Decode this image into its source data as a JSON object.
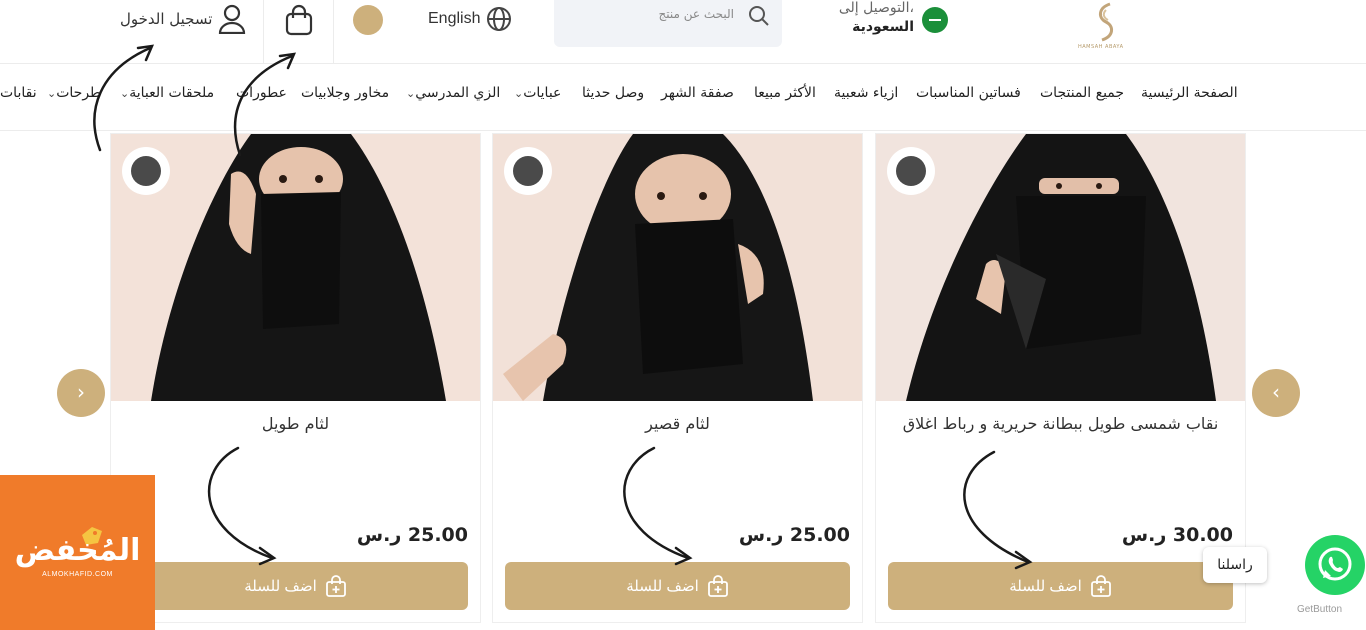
{
  "header": {
    "deliver_to_label": "التوصيل إلى،",
    "deliver_country": "السعودية",
    "search_placeholder": "البحث عن منتج",
    "language_label": "English",
    "login_label": "تسجيل الدخول",
    "logo_caption": "HAMSAH ABAYA",
    "brand_color": "#cdb07c"
  },
  "nav": {
    "items": [
      {
        "label": "الصفحة الرئيسية"
      },
      {
        "label": "جميع المنتجات"
      },
      {
        "label": "فساتين المناسبات"
      },
      {
        "label": "ازياء شعبية"
      },
      {
        "label": "الأكثر مبيعا"
      },
      {
        "label": "صفقة الشهر"
      },
      {
        "label": "وصل حديثا"
      },
      {
        "label": "عبايات",
        "has_dropdown": true
      },
      {
        "label": "الزي المدرسي",
        "has_dropdown": true
      },
      {
        "label": "مخاور وجلابيات"
      },
      {
        "label": "عطورات"
      },
      {
        "label": "ملحقات العباية",
        "has_dropdown": true
      },
      {
        "label": "طرحات",
        "has_dropdown": true
      },
      {
        "label": "نقابات"
      }
    ]
  },
  "products": [
    {
      "title": "نقاب شمسى طويل ببطانة حريرية و رباط اغلاق",
      "price": "30.00 ر.س",
      "button_label": "اضف للسلة"
    },
    {
      "title": "لثام قصير",
      "price": "25.00 ر.س",
      "button_label": "اضف للسلة"
    },
    {
      "title": "لثام طويل",
      "price": "25.00 ر.س",
      "button_label": "اضف للسلة"
    }
  ],
  "carousel": {
    "prev_glyph": "‹",
    "next_glyph": "›"
  },
  "chat": {
    "label": "راسلنا",
    "powered_by": "GetButton"
  },
  "watermark": {
    "name": "المُخفض",
    "site": "ALMOKHAFID.COM"
  }
}
